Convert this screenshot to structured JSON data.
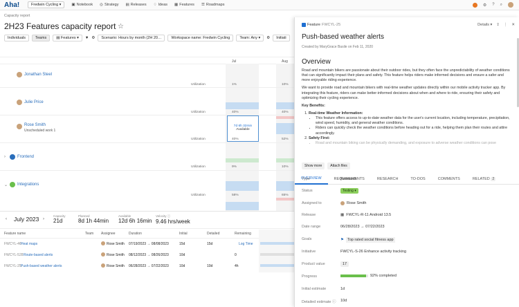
{
  "nav": {
    "logo": "Aha!",
    "workspace": "Fredwin Cycling ▾",
    "items": [
      "Notebook",
      "Strategy",
      "Releases",
      "Ideas",
      "Features",
      "Roadmaps"
    ]
  },
  "breadcrumb": "Capacity report",
  "page_title": "2H23 Features capacity report",
  "toolbar": {
    "individuals": "Individuals",
    "teams": "Teams",
    "features": "▤ Features ▾",
    "scenario": "Scenario: Hours by month (2H 20…",
    "workspace": "Workspace name: Fredwin Cycling",
    "team": "Team: Any ▾",
    "initiative": "Initiati"
  },
  "grid": {
    "months": [
      "Jul",
      "Aug"
    ],
    "rows": [
      {
        "name": "Jonathan Steel",
        "util": "Utilization",
        "p1": "1%",
        "p2": "10%"
      },
      {
        "name": "Julie Price",
        "util": "Utilization",
        "p1": "40%",
        "p2": "40%"
      },
      {
        "name": "Rose Smith",
        "sub": "Unscheduled work",
        "sub_count": "1",
        "util": "Utilization",
        "p1": "40%",
        "p2": "52%"
      },
      {
        "name": "Frontend",
        "util": "Utilization",
        "p1": "9%",
        "p2": "10%"
      },
      {
        "name": "Integrations",
        "util": "Utilization",
        "p1": "58%",
        "p2": "65%"
      }
    ],
    "avail_hours": "7d 6h 32min",
    "avail_label": "Available"
  },
  "bottom": {
    "month": "July 2023",
    "stats": [
      {
        "label": "Capacity",
        "value": "21d"
      },
      {
        "label": "Planned",
        "value": "8d 1h 44min"
      },
      {
        "label": "Available",
        "value": "12d 6h 16min"
      },
      {
        "label": "Velocity ⓘ",
        "value": "9.46 hrs/week"
      }
    ],
    "headers": [
      "Feature name",
      "Team",
      "Assignee",
      "Duration",
      "Initial",
      "Detailed",
      "Remaining"
    ],
    "rows": [
      {
        "id": "FWCYL-46",
        "name": "Heat maps",
        "assignee": "Rose Smith",
        "duration": "07/19/2023 → 08/08/2023",
        "initial": "15d",
        "detailed": "15d",
        "remaining": "Log Time"
      },
      {
        "id": "FWCYL-528",
        "name": "Route-based alerts",
        "assignee": "Rose Smith",
        "duration": "08/12/2023 → 08/26/2023",
        "initial": "10d",
        "detailed": "0",
        "remaining": ""
      },
      {
        "id": "FWCYL-25",
        "name": "Push-based weather alerts",
        "assignee": "Rose Smith",
        "duration": "06/28/2023 → 07/22/2023",
        "initial": "10d",
        "detailed": "10d",
        "remaining": "4h"
      }
    ]
  },
  "panel": {
    "type": "Feature",
    "ref": "FWCYL-25",
    "details": "Details ▾",
    "title": "Push-based weather alerts",
    "created": "Created by MaryGrace Basile on Feb 11, 2020",
    "overview": "Overview",
    "p1": "Road and mountain bikers are passionate about their outdoor rides, but they often face the unpredictability of weather conditions that can significantly impact their plans and safety. This feature helps riders make informed decisions and ensure a safer and more enjoyable riding experience.",
    "p2": "We want to provide road and mountain bikers with real-time weather updates directly within our mobile activity tracker app. By integrating this feature, riders can make better-informed decisions about when and where to ride, ensuring their safety and optimizing their cycling experience.",
    "kb": "Key Benefits:",
    "b1": "Real-time Weather Information:",
    "b1a": "This feature offers access to up-to-date weather data for the user's current location, including temperature, precipitation, wind speed, humidity, and general weather conditions.",
    "b1b": "Riders can quickly check the weather conditions before heading out for a ride, helping them plan their routes and attire accordingly.",
    "b2": "Safety First:",
    "b2a": "Road and mountain biking can be physically demanding, and exposure to adverse weather conditions can pose",
    "show_more": "Show more",
    "attach": "Attach files",
    "tabs": [
      "OVERVIEW",
      "REQUIREMENTS",
      "RESEARCH",
      "TO-DOS",
      "COMMENTS",
      "RELATED"
    ],
    "related_count": "2",
    "fields": [
      {
        "label": "Type",
        "value": "Research"
      },
      {
        "label": "Status",
        "value": "Testing ▾"
      },
      {
        "label": "Assigned to",
        "value": "Rose Smith"
      },
      {
        "label": "Release",
        "value": "FWCYL-R-11 Android 13.5"
      },
      {
        "label": "Date range",
        "value": "06/28/2023  →  07/22/2023"
      },
      {
        "label": "Goals",
        "value": "Top rated social fitness app"
      },
      {
        "label": "Initiative",
        "value": "FWCYL-S-26 Enhance activity tracking"
      },
      {
        "label": "Product value",
        "value": "17"
      },
      {
        "label": "Progress",
        "value": "92% completed",
        "progress": 0.92
      },
      {
        "label": "Initial estimate",
        "value": "1d"
      },
      {
        "label": "Detailed estimate ⓘ",
        "value": "10d"
      }
    ]
  }
}
